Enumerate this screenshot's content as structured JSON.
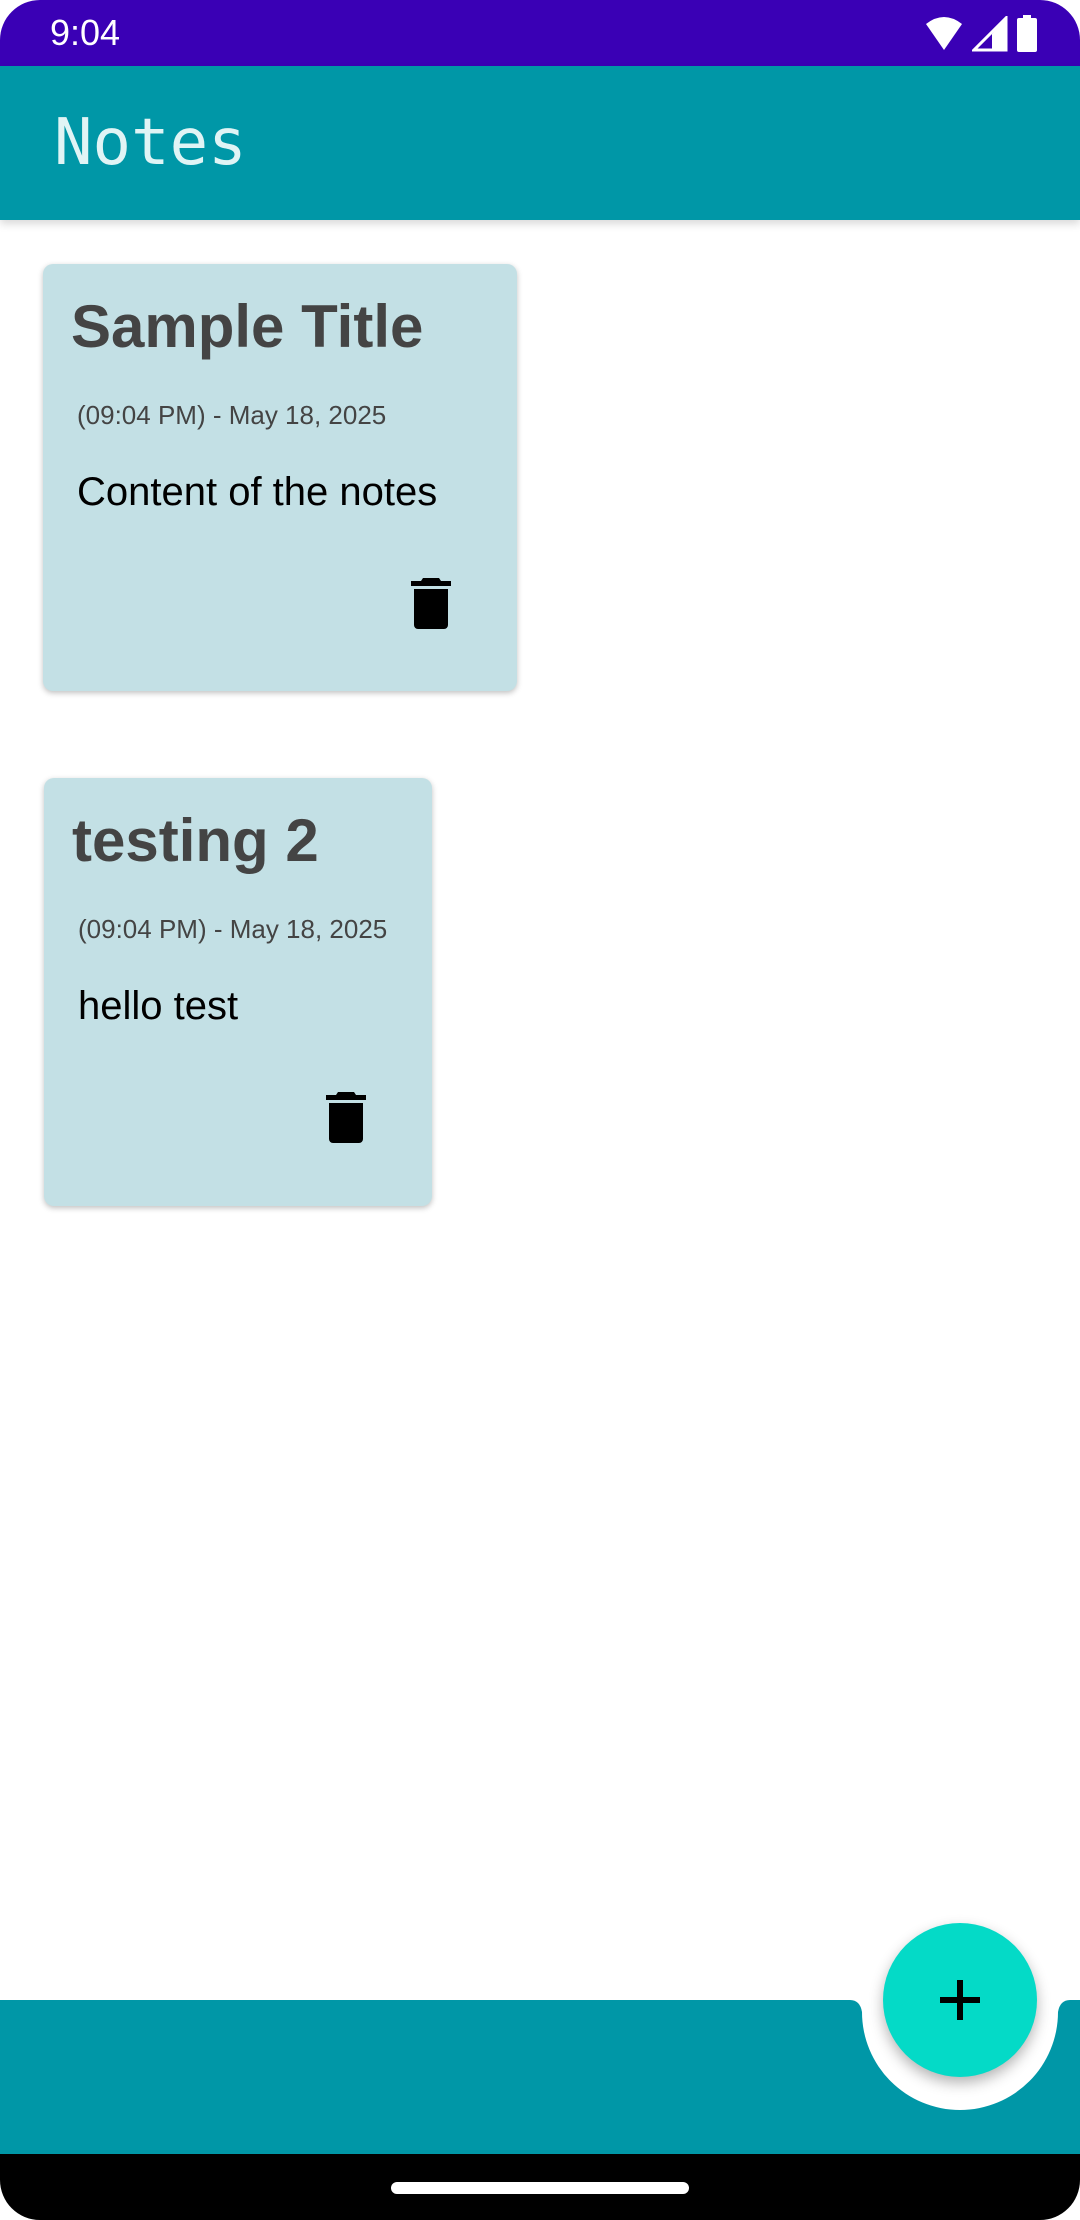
{
  "status_bar": {
    "time": "9:04",
    "icons": [
      "wifi-icon",
      "signal-icon",
      "battery-icon"
    ]
  },
  "app_bar": {
    "title": "Notes"
  },
  "notes": [
    {
      "title": "Sample Title",
      "timestamp": "(09:04 PM) - May 18, 2025",
      "content": "Content of the notes"
    },
    {
      "title": "testing 2",
      "timestamp": "(09:04 PM) - May 18, 2025",
      "content": "hello test"
    }
  ],
  "colors": {
    "status_bar": "#3a00b5",
    "app_bar": "#0097a7",
    "card": "#c3e0e5",
    "fab": "#04dac7"
  },
  "fab": {
    "icon": "plus-icon"
  }
}
